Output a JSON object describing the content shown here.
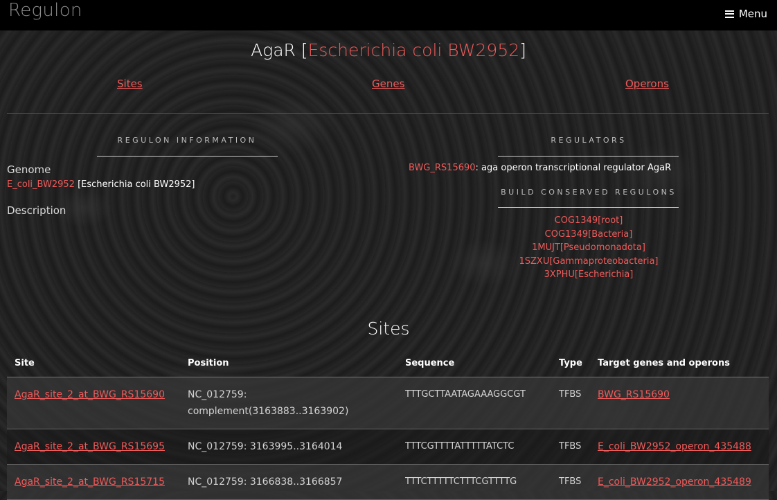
{
  "header": {
    "logo": "Regulon",
    "menu_label": "Menu"
  },
  "title": {
    "name": "AgaR",
    "open_bracket": "[",
    "organism": "Escherichia coli BW2952",
    "close_bracket": "]"
  },
  "nav": {
    "sites": "Sites",
    "genes": "Genes",
    "operons": "Operons"
  },
  "regulon_info": {
    "heading": "REGULON INFORMATION",
    "genome_label": "Genome",
    "genome_link": "E_coli_BW2952",
    "genome_name": "[Escherichia coli BW2952]",
    "description_label": "Description"
  },
  "regulators": {
    "heading": "REGULATORS",
    "regulator_link": "BWG_RS15690",
    "regulator_desc": ": aga operon transcriptional regulator AgaR",
    "build_heading": "BUILD CONSERVED REGULONS",
    "cogs": [
      "COG1349[root]",
      "COG1349[Bacteria]",
      "1MUJT[Pseudomonadota]",
      "1SZXU[Gammaproteobacteria]",
      "3XPHU[Escherichia]"
    ]
  },
  "sites": {
    "title": "Sites",
    "columns": [
      "Site",
      "Position",
      "Sequence",
      "Type",
      "Target genes and operons"
    ],
    "rows": [
      {
        "site": "AgaR_site_2_at_BWG_RS15690",
        "position": "NC_012759: complement(3163883..3163902)",
        "sequence": "TTTGCTTAATAGAAAGGCGT",
        "type": "TFBS",
        "target": "BWG_RS15690"
      },
      {
        "site": "AgaR_site_2_at_BWG_RS15695",
        "position": "NC_012759: 3163995..3164014",
        "sequence": "TTTCGTTTTATTTTTATCTC",
        "type": "TFBS",
        "target": "E_coli_BW2952_operon_435488"
      },
      {
        "site": "AgaR_site_2_at_BWG_RS15715",
        "position": "NC_012759: 3166838..3166857",
        "sequence": "TTTCTTTTTCTTTCGTTTTG",
        "type": "TFBS",
        "target": "E_coli_BW2952_operon_435489"
      }
    ]
  },
  "colors": {
    "accent": "#f05a5a",
    "topbar": "#000000"
  }
}
